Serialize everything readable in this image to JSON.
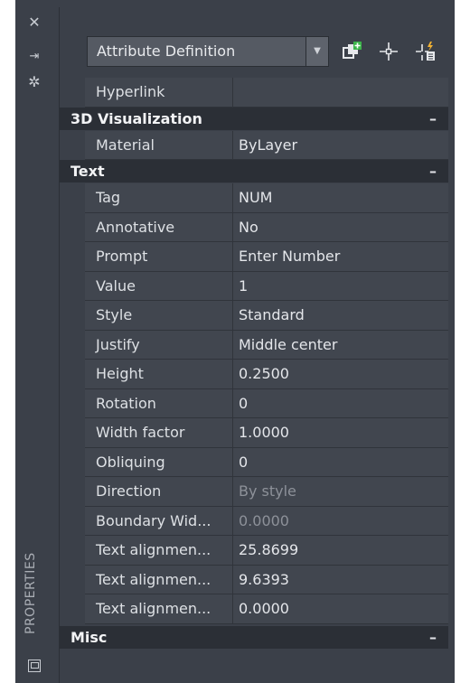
{
  "sidebar": {
    "title": "PROPERTIES",
    "icons": [
      "close-icon",
      "auto-hide-icon",
      "settings-icon"
    ]
  },
  "toolbar": {
    "object_type": "Attribute Definition",
    "icons": [
      "quick-select-add-icon",
      "select-objects-icon",
      "toggle-pickadd-icon"
    ]
  },
  "rows_top": [
    {
      "label": "Hyperlink",
      "value": ""
    }
  ],
  "categories": {
    "viz": {
      "label": "3D Visualization",
      "toggle": "–"
    },
    "text": {
      "label": "Text",
      "toggle": "–"
    },
    "misc": {
      "label": "Misc",
      "toggle": "–"
    }
  },
  "viz_rows": [
    {
      "label": "Material",
      "value": "ByLayer"
    }
  ],
  "text_rows": [
    {
      "label": "Tag",
      "value": "NUM"
    },
    {
      "label": "Annotative",
      "value": "No"
    },
    {
      "label": "Prompt",
      "value": "Enter Number"
    },
    {
      "label": "Value",
      "value": "1"
    },
    {
      "label": "Style",
      "value": "Standard"
    },
    {
      "label": "Justify",
      "value": "Middle center"
    },
    {
      "label": "Height",
      "value": "0.2500"
    },
    {
      "label": "Rotation",
      "value": "0"
    },
    {
      "label": "Width factor",
      "value": "1.0000"
    },
    {
      "label": "Obliquing",
      "value": "0"
    },
    {
      "label": "Direction",
      "value": "By style"
    },
    {
      "label": "Boundary Wid...",
      "value": "0.0000"
    },
    {
      "label": "Text alignmen...",
      "value": "25.8699"
    },
    {
      "label": "Text alignmen...",
      "value": "9.6393"
    },
    {
      "label": "Text alignmen...",
      "value": "0.0000"
    }
  ],
  "colors": {
    "panel_bg": "#3b4049",
    "category_bg": "#2b2f36",
    "row_bg": "#41464f",
    "text": "#e4e6ea",
    "disabled_text": "#8d9199"
  }
}
